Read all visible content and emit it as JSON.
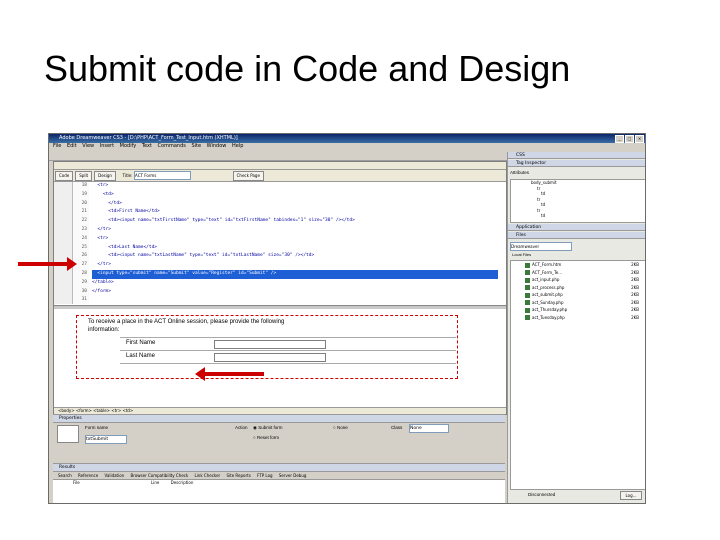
{
  "slide": {
    "title": "Submit code in Code and Design"
  },
  "window": {
    "title": "Adobe Dreamweaver CS3 - [D:\\PHP\\ACT_Form_Test_Input.htm (XHTML)]",
    "menu": [
      "File",
      "Edit",
      "View",
      "Insert",
      "Modify",
      "Text",
      "Commands",
      "Site",
      "Window",
      "Help"
    ]
  },
  "document": {
    "toolbar": {
      "code": "Code",
      "split": "Split",
      "design": "Design",
      "title_label": "Title:",
      "title_value": "ACT Forms",
      "check_page": "Check Page"
    },
    "line_numbers": [
      "18",
      "19",
      "20",
      "21",
      "22",
      "23",
      "24",
      "25",
      "26",
      "27",
      "28",
      "29",
      "30",
      "31"
    ],
    "code_lines": [
      "  <tr>",
      "    <td>",
      "      </td>",
      "      <td>First Name</td>",
      "      <td><input name=\"txtFirstName\" type=\"text\" id=\"txtFirstName\" tabindex=\"1\" size=\"30\" /></td>",
      "  </tr>",
      "  <tr>",
      "      <td>Last Name</td>",
      "      <td><input name=\"txtLastName\" type=\"text\" id=\"txtLastName\" size=\"30\" /></td>",
      "  </tr>",
      "  <input type=\"submit\" name=\"Submit\" value=\"Register\" id=\"Submit\" />",
      "</table>",
      "</form>",
      ""
    ],
    "design": {
      "intro_line1": "To receive a place in the ACT Online session, please provide the following",
      "intro_line2": "information:",
      "first_name_label": "First Name",
      "last_name_label": "Last Name"
    },
    "status": "<body> <form> <table> <tr> <td>"
  },
  "properties": {
    "header": "Properties",
    "form_name_label": "Form name",
    "form_name_value": "txtSubmit",
    "action_label": "Action",
    "submit_option": "Submit form",
    "reset_option": "Reset form",
    "none_option": "None",
    "class_label": "Class",
    "class_value": "None"
  },
  "results": {
    "header": "Results",
    "tabs": [
      "Search",
      "Reference",
      "Validation",
      "Browser Compatibility Check",
      "Link Checker",
      "Site Reports",
      "FTP Log",
      "Server Debug"
    ],
    "columns": [
      "File",
      "Line",
      "Description"
    ]
  },
  "right": {
    "css_header": "CSS",
    "tag_header": "Tag Inspector",
    "attributes_label": "Attributes",
    "tree": [
      "body_submit",
      "tr",
      "td",
      "tr",
      "td",
      "tr",
      "td"
    ],
    "application_header": "Application",
    "files_header": "Files",
    "site_select": "Dreamweaver",
    "local_files": "Local Files",
    "files": [
      {
        "name": "ACT_Form.htm",
        "size": "2KB"
      },
      {
        "name": "ACT_Form_Te...",
        "size": "2KB"
      },
      {
        "name": "act_input.php",
        "size": "2KB"
      },
      {
        "name": "act_process.php",
        "size": "2KB"
      },
      {
        "name": "act_submit.php",
        "size": "2KB"
      },
      {
        "name": "act_Sunday.php",
        "size": "2KB"
      },
      {
        "name": "act_Thursday.php",
        "size": "2KB"
      },
      {
        "name": "act_Tuesday.php",
        "size": "2KB"
      }
    ],
    "disconnected": "Disconnected",
    "log_button": "Log..."
  },
  "colors": {
    "arrow": "#cc0000",
    "title_bar": "#0a246a",
    "selection": "#1f5fd6"
  }
}
